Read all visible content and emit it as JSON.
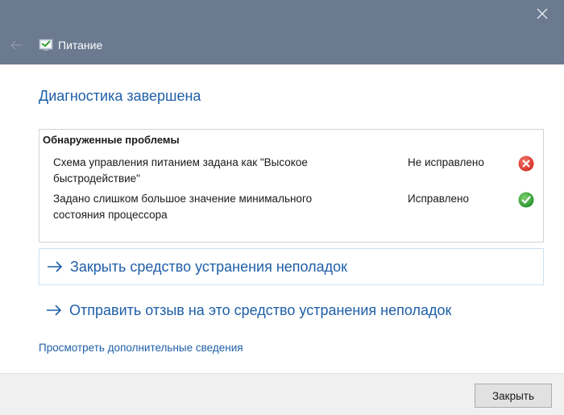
{
  "window": {
    "title": "Питание",
    "icons": {
      "back": "back-arrow-icon",
      "close": "close-icon",
      "app": "power-troubleshooter-icon"
    }
  },
  "main": {
    "heading": "Диагностика завершена",
    "problems": {
      "title": "Обнаруженные проблемы",
      "items": [
        {
          "line1": "Схема управления питанием задана как \"Высокое",
          "line2": "быстродействие\"",
          "status": "Не исправлено",
          "icon": "error-icon",
          "icon_color": "#e0312d"
        },
        {
          "line1": "Задано слишком большое значение минимального",
          "line2": "состояния процессора",
          "status": "Исправлено",
          "icon": "checkmark-icon",
          "icon_color": "#2e9f2e"
        }
      ]
    },
    "links": {
      "close_troubleshooter": "Закрыть средство устранения неполадок",
      "send_feedback": "Отправить отзыв на это средство устранения неполадок",
      "more_info": "Просмотреть дополнительные сведения"
    }
  },
  "footer": {
    "close_button": "Закрыть"
  },
  "colors": {
    "titlebar": "#6b7a8f",
    "link": "#1f5fa8",
    "footer": "#f0f0f0"
  }
}
